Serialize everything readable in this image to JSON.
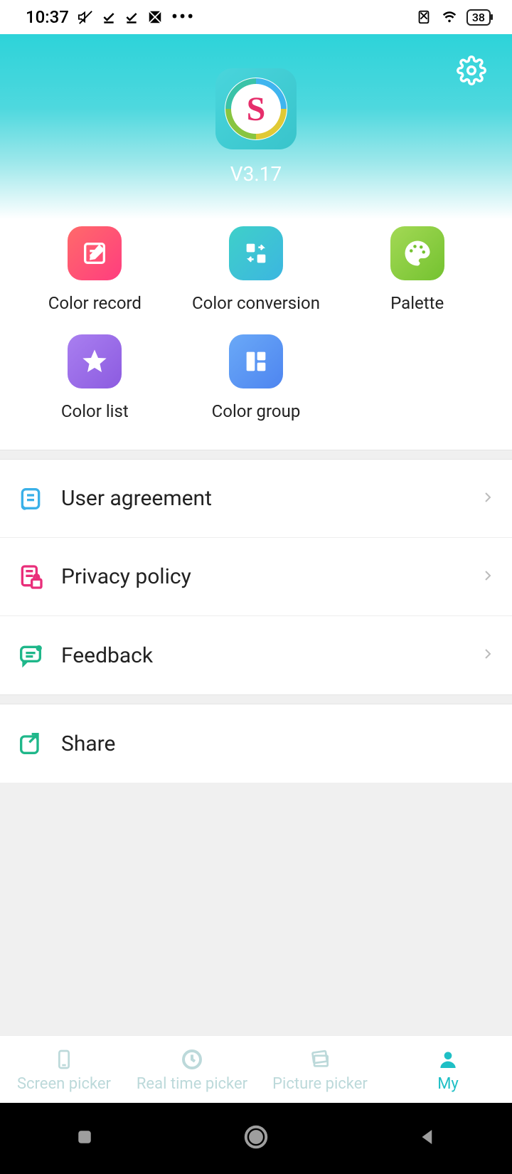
{
  "status": {
    "time": "10:37",
    "battery": "38"
  },
  "header": {
    "version": "V3.17"
  },
  "grid": {
    "items": [
      {
        "label": "Color record"
      },
      {
        "label": "Color conversion"
      },
      {
        "label": "Palette"
      },
      {
        "label": "Color list"
      },
      {
        "label": "Color group"
      }
    ]
  },
  "settings": {
    "group1": [
      {
        "label": "User agreement"
      },
      {
        "label": "Privacy policy"
      },
      {
        "label": "Feedback"
      }
    ],
    "group2": [
      {
        "label": "Share"
      }
    ]
  },
  "nav": {
    "items": [
      {
        "label": "Screen picker"
      },
      {
        "label": "Real time picker"
      },
      {
        "label": "Picture picker"
      },
      {
        "label": "My"
      }
    ]
  }
}
